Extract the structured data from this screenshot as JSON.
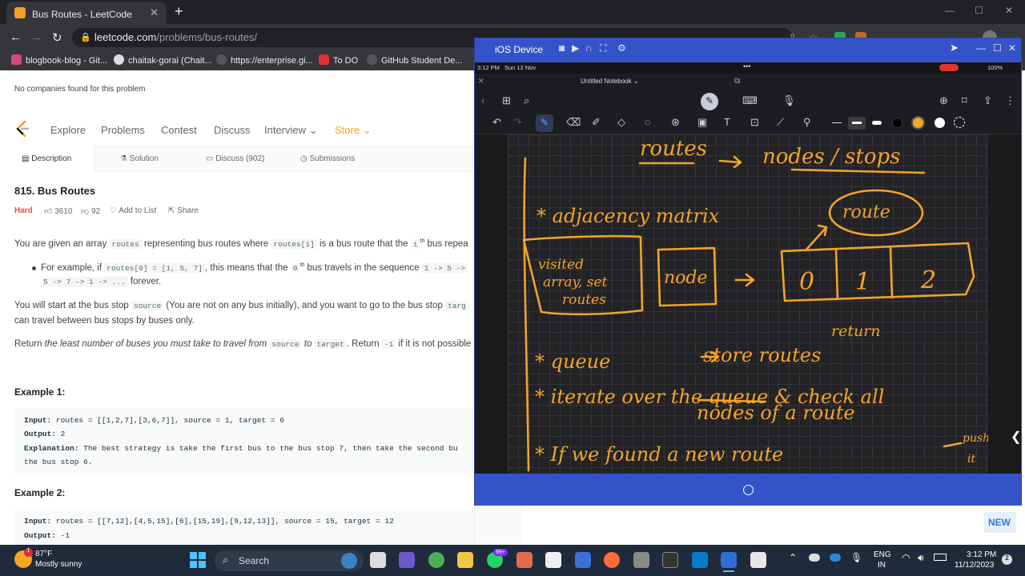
{
  "browser": {
    "tab_title": "Bus Routes - LeetCode",
    "url_domain": "leetcode.com",
    "url_path": "/problems/bus-routes/",
    "bookmarks": [
      "blogbook-blog - Git...",
      "chaitak-gorai (Chait...",
      "https://enterprise.gi...",
      "To DO",
      "GitHub Student De..."
    ]
  },
  "leetcode": {
    "no_companies": "No companies found for this problem",
    "nav": [
      "Explore",
      "Problems",
      "Contest",
      "Discuss",
      "Interview",
      "Store"
    ],
    "tabs": [
      "Description",
      "Solution",
      "Discuss (902)",
      "Submissions"
    ],
    "title": "815. Bus Routes",
    "difficulty": "Hard",
    "likes": "3610",
    "dislikes": "92",
    "add_to_list": "Add to List",
    "share": "Share",
    "p1": [
      "You are given an array",
      "routes",
      "representing bus routes where",
      "routes[i]",
      "is a bus route that the",
      "i",
      "th",
      "bus repea"
    ],
    "bullet": [
      "For example, if",
      "routes[0] = [1, 5, 7]",
      ", this means that the",
      "0",
      "th",
      "bus travels in the sequence",
      "1 -> 5 ->"
    ],
    "bullet2": [
      "5 -> 7 -> 1 -> ...",
      "forever."
    ],
    "p2": [
      "You will start at the bus stop",
      "source",
      "(You are not on any bus initially), and you want to go to the bus stop",
      "targ"
    ],
    "p2b": "can travel between bus stops by buses only.",
    "p3": [
      "Return",
      "the least number of buses you must take to travel from",
      "source",
      "to",
      "target",
      ". Return",
      "-1",
      "if it is not possible"
    ],
    "example1": {
      "heading": "Example 1:",
      "input": "routes = [[1,2,7],[3,6,7]], source = 1, target = 6",
      "output": "2",
      "explanation": "The best strategy is take the first bus to the bus stop 7, then take the second bu",
      "explanation2": "the bus stop 6."
    },
    "example2": {
      "heading": "Example 2:",
      "input": "routes = [[7,12],[4,5,15],[6],[15,19],[9,12,13]], source = 15, target = 12",
      "output": "-1"
    },
    "labels": {
      "input": "Input:",
      "output": "Output:",
      "explanation": "Explanation:"
    }
  },
  "ios_window": {
    "title": "iOS Device",
    "status_time": "3:12 PM",
    "status_date": "Sun 12 Nov",
    "battery": "100%",
    "notebook_title": "Untitled Notebook"
  },
  "notes": {
    "line1": "routes → nodes / stops",
    "line2": "* adjacency matrix",
    "route_circle": "route",
    "visited_box": "visited array, set routes",
    "node_box": "node",
    "cells": [
      "0",
      "1",
      "2"
    ],
    "return_word": "return",
    "line3": "queue → store routes",
    "line4": "iterate over the queue & check all",
    "line5": "nodes of a route",
    "line6": "If we found a new route → push it"
  },
  "new_badge": "NEW",
  "taskbar": {
    "temp": "87°F",
    "weather": "Mostly sunny",
    "search": "Search",
    "lang1": "ENG",
    "lang2": "IN",
    "time": "3:12 PM",
    "date": "11/12/2023",
    "notif_count": "2",
    "badge_99": "99+"
  }
}
